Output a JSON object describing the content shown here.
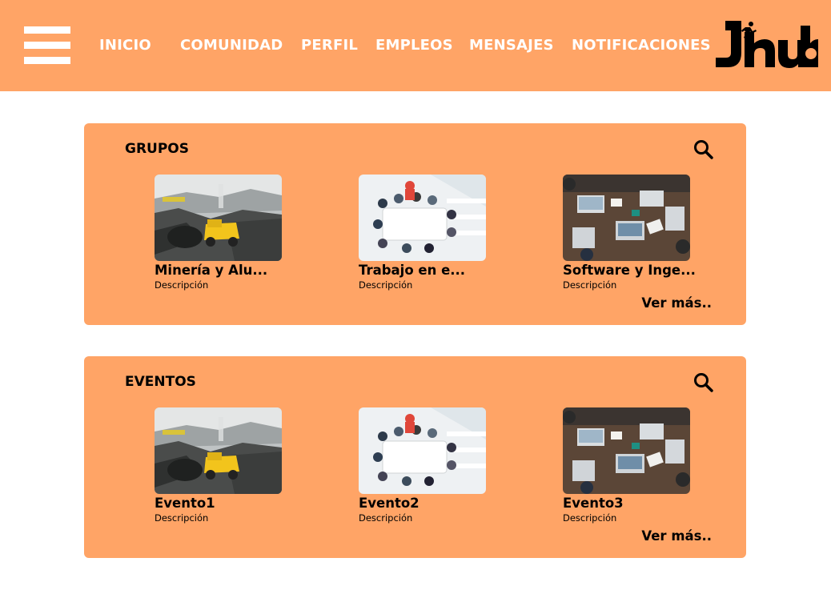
{
  "header": {
    "nav": [
      {
        "label": "INICIO"
      },
      {
        "label": "COMUNIDAD"
      },
      {
        "label": "PERFIL"
      },
      {
        "label": "EMPLEOS"
      },
      {
        "label": "MENSAJES"
      },
      {
        "label": "NOTIFICACIONES"
      }
    ],
    "logo_text": "Jhub",
    "logo_icon": "running-person-icon",
    "menu_icon": "hamburger-menu-icon"
  },
  "groups": {
    "title": "GRUPOS",
    "search_icon": "search-icon",
    "items": [
      {
        "title": "Minería y Alu...",
        "description": "Descripción",
        "image": "mining-truck-photo"
      },
      {
        "title": "Trabajo en e...",
        "description": "Descripción",
        "image": "team-meeting-photo"
      },
      {
        "title": "Software y Inge...",
        "description": "Descripción",
        "image": "laptops-desk-photo"
      }
    ],
    "see_more": "Ver más.."
  },
  "events": {
    "title": "EVENTOS",
    "search_icon": "search-icon",
    "items": [
      {
        "title": "Evento1",
        "description": "Descripción",
        "image": "mining-truck-photo"
      },
      {
        "title": "Evento2",
        "description": "Descripción",
        "image": "team-meeting-photo"
      },
      {
        "title": "Evento3",
        "description": "Descripción",
        "image": "laptops-desk-photo"
      }
    ],
    "see_more": "Ver más.."
  },
  "colors": {
    "primary": "#FFA466",
    "nav_text": "#FFFFFF",
    "text": "#000000",
    "background": "#FFFFFF"
  }
}
